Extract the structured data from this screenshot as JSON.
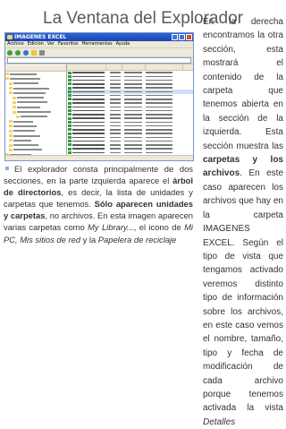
{
  "slide": {
    "title": "La Ventana del Explorador"
  },
  "window": {
    "title": "IMAGENES EXCEL",
    "menu": [
      "Archivo",
      "Edición",
      "Ver",
      "Favoritos",
      "Herramientas",
      "Ayuda"
    ]
  },
  "right_text": {
    "p1": "En la derecha encontramos la otra sección, esta mostrará el contenido de la carpeta que tenemos abierta en la sección de la izquierda. Esta sección muestra las ",
    "p1_bold": "carpetas y los archivos",
    "p2": ". En este caso aparecen los archivos que hay en la carpeta IMAGENES EXCEL. Según el tipo de vista que tengamos activado veremos distinto tipo de información sobre los archivos, en este caso vemos el nombre, tamaño, tipo y fecha de modificación de cada archivo porque tenemos activada la vista ",
    "p2_italic": "Detalles"
  },
  "bottom_text": {
    "a": "El explorador consta principalmente de dos secciones, en la parte izquierda aparece el ",
    "a_bold": "árbol de directorios",
    "b": ", es decir, la lista de unidades y carpetas que tenemos. ",
    "b_bold": "Sólo aparecen unidades y carpetas",
    "c": ", no archivos. En esta imagen aparecen varias carpetas como ",
    "c_italic": "My Library...",
    "d": ", el icono de ",
    "d_italic": "Mi PC, Mis sitios de red",
    "e": " y la ",
    "e_italic": "Papelera de reciclaje"
  }
}
